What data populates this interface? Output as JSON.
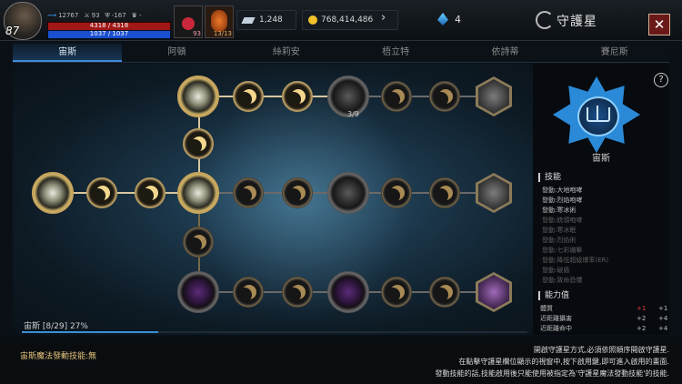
{
  "player": {
    "level": "87",
    "stat_a": "12767",
    "stat_b": "93",
    "stat_c": "-167",
    "stat_d": "-",
    "hp_text": "4318 / 4318",
    "mp_text": "1037 / 1037",
    "potion1_count": "93",
    "potion2_count": "13/13"
  },
  "currency": {
    "diamonds": "1,248",
    "gold": "768,414,486",
    "crystals": "4"
  },
  "window": {
    "title": "守護星",
    "close_label": "✕"
  },
  "tabs": [
    {
      "label": "宙斯",
      "active": true
    },
    {
      "label": "阿頓",
      "active": false
    },
    {
      "label": "絲莉安",
      "active": false
    },
    {
      "label": "梧立特",
      "active": false
    },
    {
      "label": "依詩蒂",
      "active": false
    },
    {
      "label": "賽尼斯",
      "active": false
    }
  ],
  "tree": {
    "large_node_count": "3/9",
    "progress_label": "宙斯 [8/29] 27%",
    "progress_value": 27
  },
  "detail": {
    "name": "宙斯",
    "help_label": "?",
    "skills_title": "技能",
    "skills": [
      {
        "name": "發動:大地咆哮",
        "active": true
      },
      {
        "name": "發動:烈焰咆哮",
        "active": true
      },
      {
        "name": "發動:寒冰術",
        "active": true
      },
      {
        "name": "發動:統領咆哮",
        "active": false
      },
      {
        "name": "發動:寒冰眠",
        "active": false
      },
      {
        "name": "發動:烈焰術",
        "active": false
      },
      {
        "name": "發動:七彩繃擊",
        "active": false
      },
      {
        "name": "發動:降低超級爆率(ER)",
        "active": false
      },
      {
        "name": "發動:破盾",
        "active": false
      },
      {
        "name": "發動:致命恐懼",
        "active": false
      }
    ],
    "abilities_title": "能力值",
    "abilities": [
      {
        "name": "體質",
        "current": "+1",
        "next": "+1",
        "highlight": true
      },
      {
        "name": "近距離攝害",
        "current": "+2",
        "next": "+4",
        "highlight": false
      },
      {
        "name": "近距離命中",
        "current": "+2",
        "next": "+4",
        "highlight": false
      }
    ]
  },
  "footer": {
    "magic_label": "宙斯魔法發動技能:無",
    "notes": [
      "開啟守護星方式,必須依照順序開啟守護星.",
      "在點擊守護星欄位顯示的視窗中,按下啟用鍵,即可進入啟用的畫面.",
      "發動技能的話,技能啟用後只能使用被指定為'守護星魔法發動技能'的技能."
    ]
  }
}
